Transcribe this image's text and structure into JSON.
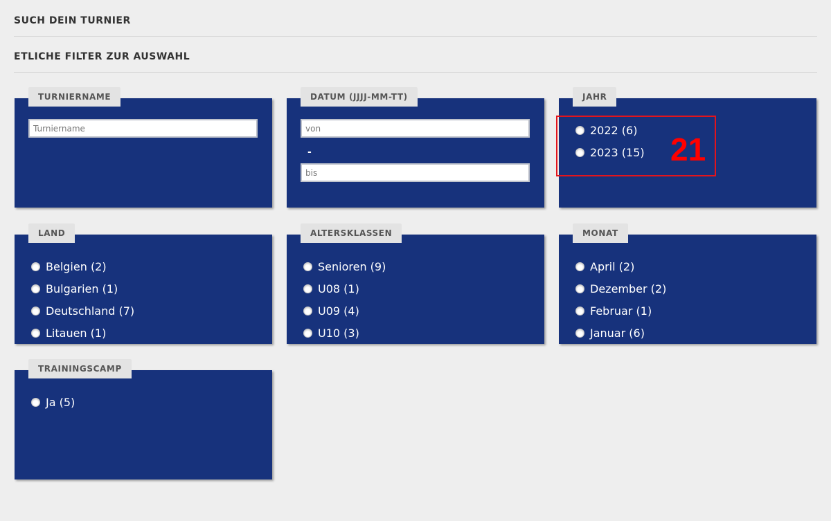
{
  "headings": {
    "search_title": "SUCH DEIN TURNIER",
    "filter_title": "ETLICHE FILTER ZUR AUSWAHL"
  },
  "colors": {
    "page_bg": "#eeeeee",
    "panel_bg": "#17327c",
    "tab_bg": "#e3e3e3",
    "annotation": "#ff0000"
  },
  "panels": {
    "turniername": {
      "title": "TURNIERNAME",
      "input_placeholder": "Turniername",
      "input_value": ""
    },
    "datum": {
      "title": "DATUM (JJJJ-MM-TT)",
      "from_placeholder": "von",
      "from_value": "",
      "separator": "-",
      "to_placeholder": "bis",
      "to_value": ""
    },
    "jahr": {
      "title": "JAHR",
      "options": [
        "2022 (6)",
        "2023 (15)"
      ]
    },
    "land": {
      "title": "LAND",
      "options": [
        "Belgien (2)",
        "Bulgarien (1)",
        "Deutschland (7)",
        "Litauen (1)"
      ]
    },
    "altersklassen": {
      "title": "ALTERSKLASSEN",
      "options": [
        "Senioren (9)",
        "U08 (1)",
        "U09 (4)",
        "U10 (3)"
      ]
    },
    "monat": {
      "title": "MONAT",
      "options": [
        "April (2)",
        "Dezember (2)",
        "Februar (1)",
        "Januar (6)"
      ]
    },
    "trainingscamp": {
      "title": "TRAININGSCAMP",
      "options": [
        "Ja (5)"
      ]
    }
  },
  "annotation": {
    "label": "21"
  }
}
